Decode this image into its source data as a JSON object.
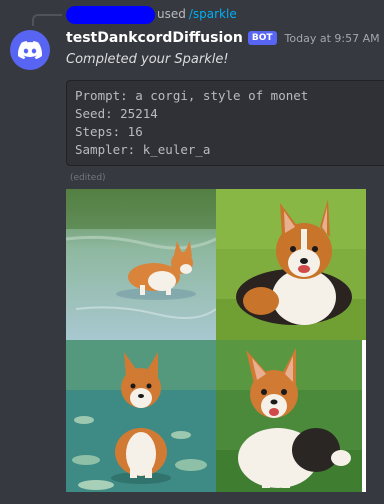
{
  "reply": {
    "used_text": "used",
    "command": "/sparkle"
  },
  "message": {
    "username": "testDankcordDiffusion",
    "badge": "BOT",
    "timestamp": "Today at 9:57 AM",
    "status": "Completed your Sparkle!",
    "edited": "(edited)"
  },
  "code": {
    "prompt_line": "Prompt: a corgi, style of monet",
    "seed_line": "Seed: 25214",
    "steps_line": "Steps: 16",
    "sampler_line": "Sampler: k_euler_a"
  },
  "images": [
    {
      "name": "corgi-image-1",
      "desc": "corgi standing in water"
    },
    {
      "name": "corgi-image-2",
      "desc": "corgi sitting on grass"
    },
    {
      "name": "corgi-image-3",
      "desc": "corgi sitting among water lilies"
    },
    {
      "name": "corgi-image-4",
      "desc": "corgi sitting on green background"
    }
  ],
  "colors": {
    "background": "#36393f",
    "accent": "#5865f2",
    "command": "#00aff4",
    "redaction": "#0000fe"
  }
}
